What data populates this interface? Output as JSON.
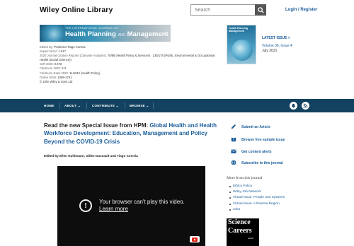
{
  "header": {
    "logo": "Wiley Online Library",
    "search_placeholder": "Search",
    "login": "Login / Register"
  },
  "journal": {
    "banner_small": "THE INTERNATIONAL JOURNAL OF",
    "banner_title_a": "Health Planning",
    "banner_and": "AND",
    "banner_title_b": "Management",
    "cover_title": "Health Planning Management",
    "latest_issue_label": "LATEST ISSUE",
    "latest_issue_arrow": ">",
    "volume": "Volume 36, Issue 4",
    "date": "July 2021",
    "meta": [
      {
        "label": "Edited By: ",
        "value": "Professor Tiago Correia"
      },
      {
        "label": "Impact factor: ",
        "value": "1.517"
      },
      {
        "label": "2020 Journal Citation Reports (Clarivate Analytics): ",
        "value": "76/88 (Health Policy & Services) · 135/176 (Public, Environmental & Occupational Health (Social Science))"
      },
      {
        "label": "SJR 2020: ",
        "value": "0.672"
      },
      {
        "label": "CiteScore 2020: ",
        "value": "2.3"
      },
      {
        "label": "CiteScore Rank 2020: ",
        "value": "114/242 (Health Policy)"
      },
      {
        "label": "Online ISSN: ",
        "value": "1099-1751"
      },
      {
        "label": "",
        "value": "© John Wiley & Sons Ltd"
      }
    ]
  },
  "nav": {
    "items": [
      "HOME",
      "ABOUT",
      "CONTRIBUTE",
      "BROWSE"
    ],
    "chevron": "⌄"
  },
  "main": {
    "headline_prefix": "Read the new Special Issue from HPM: ",
    "headline_link": "Global Health and Health Workforce Development: Education, Management and Policy Beyond the COVID-19 Crisis",
    "editors": "Edited by Ellen Kuhlmann, Gilles Dussault and Tiago Correia",
    "video_icon": "!",
    "video_message": "Your browser can't play this video.",
    "video_link": "Learn more"
  },
  "sidebar": {
    "links": [
      {
        "label": "Submit an Article",
        "icon": "pencil-icon"
      },
      {
        "label": "Browse free sample issue",
        "icon": "book-icon"
      },
      {
        "label": "Get content alerts",
        "icon": "envelope-icon"
      },
      {
        "label": "Subscribe to this journal",
        "icon": "globe-icon"
      }
    ],
    "more_title": "More from this journal",
    "more_items": [
      "Ethics Policy",
      "Wiley Job Network",
      "Virtual Issue: People and Systems",
      "Virtual Issue: A Diverse Region",
      "Jobs"
    ],
    "ad_line1": "Science",
    "ad_line2": "Careers",
    "ad_line3": "AAAS"
  },
  "colors": {
    "nav_bg": "#12425f",
    "link": "#1a5d9a"
  }
}
